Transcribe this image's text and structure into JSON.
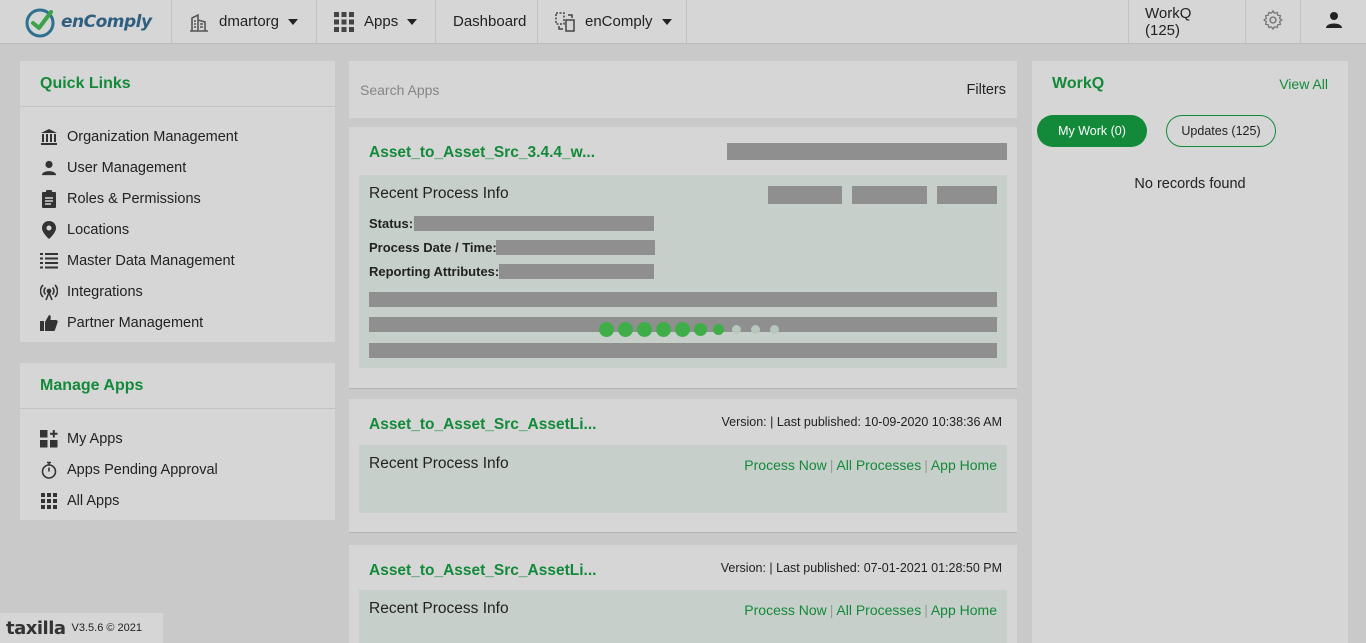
{
  "topbar": {
    "logo_text": "enComply",
    "org": "dmartorg",
    "apps": "Apps",
    "dashboard": "Dashboard",
    "product": "enComply",
    "workq": "WorkQ (125)"
  },
  "quick_links": {
    "title": "Quick Links",
    "items": [
      {
        "label": "Organization Management",
        "icon": "bank-icon"
      },
      {
        "label": "User Management",
        "icon": "user-icon"
      },
      {
        "label": "Roles & Permissions",
        "icon": "clipboard-icon"
      },
      {
        "label": "Locations",
        "icon": "map-pin-icon"
      },
      {
        "label": "Master Data Management",
        "icon": "list-icon"
      },
      {
        "label": "Integrations",
        "icon": "antenna-icon"
      },
      {
        "label": "Partner Management",
        "icon": "thumbs-up-icon"
      }
    ]
  },
  "manage_apps": {
    "title": "Manage Apps",
    "items": [
      {
        "label": "My Apps",
        "icon": "apps-plus-icon"
      },
      {
        "label": "Apps Pending Approval",
        "icon": "stopwatch-icon"
      },
      {
        "label": "All Apps",
        "icon": "grid-icon"
      }
    ]
  },
  "search": {
    "placeholder": "Search Apps",
    "filters": "Filters"
  },
  "apps": [
    {
      "title": "Asset_to_Asset_Src_3.4.4_w...",
      "recent_title": "Recent Process Info",
      "status_label": "Status:",
      "date_label": "Process Date / Time:",
      "attr_label": "Reporting Attributes:"
    },
    {
      "title": "Asset_to_Asset_Src_AssetLi...",
      "meta": "Version: | Last published: 10-09-2020 10:38:36 AM",
      "recent_title": "Recent Process Info",
      "process_now": "Process Now",
      "all_processes": "All Processes",
      "app_home": "App Home"
    },
    {
      "title": "Asset_to_Asset_Src_AssetLi...",
      "meta": "Version: | Last published: 07-01-2021 01:28:50 PM",
      "recent_title": "Recent Process Info",
      "process_now": "Process Now",
      "all_processes": "All Processes",
      "app_home": "App Home"
    }
  ],
  "workq": {
    "title": "WorkQ",
    "view_all": "View All",
    "my_work": "My Work (0)",
    "updates": "Updates (125)",
    "empty": "No records found"
  },
  "footer": {
    "brand": "taxilla",
    "version": "V3.5.6 © 2021"
  },
  "colors": {
    "accent": "#138a3a",
    "loader": "#3fae49"
  }
}
